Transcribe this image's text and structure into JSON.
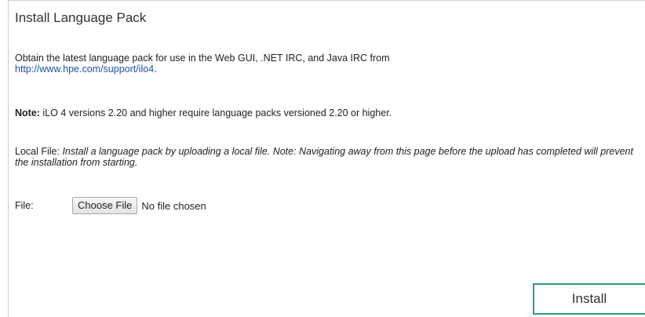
{
  "section": {
    "title": "Install Language Pack"
  },
  "intro": {
    "text": "Obtain the latest language pack for use in the Web GUI, .NET IRC, and Java IRC from",
    "link_text": "http://www.hpe.com/support/ilo4",
    "suffix": "."
  },
  "note": {
    "label": "Note:",
    "text": " iLO 4 versions 2.20 and higher require language packs versioned 2.20 or higher."
  },
  "local_file": {
    "label": "Local File: ",
    "text": "Install a language pack by uploading a local file.  Note: Navigating away from this page before the upload has completed will prevent the installation from starting."
  },
  "file_input": {
    "label": "File:",
    "button_label": "Choose File",
    "status": "No file chosen"
  },
  "actions": {
    "install_label": "Install"
  },
  "colors": {
    "link": "#1f4fa8",
    "install_border": "#2a9d7e"
  }
}
